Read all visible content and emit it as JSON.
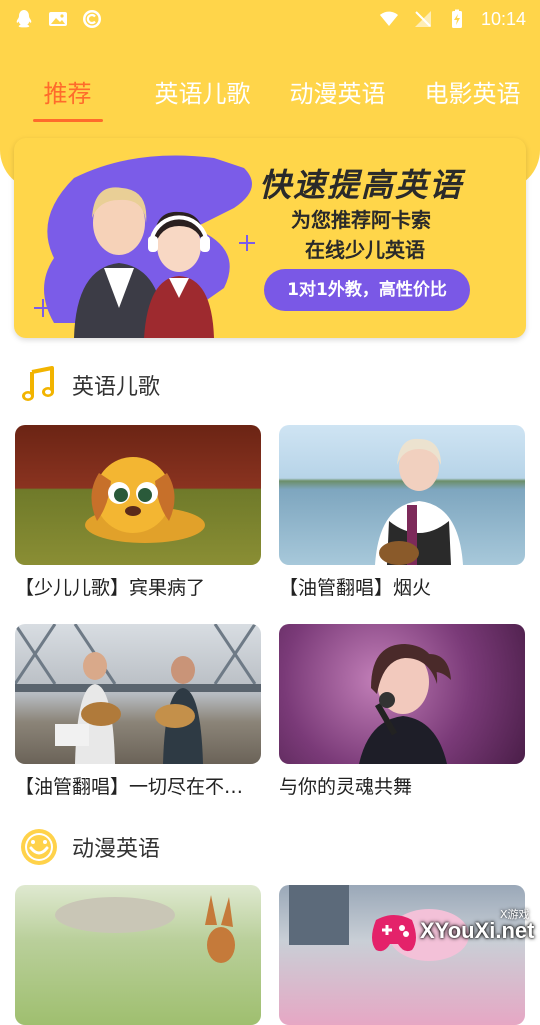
{
  "status_bar": {
    "time": "10:14"
  },
  "tabs": [
    {
      "label": "推荐",
      "active": true
    },
    {
      "label": "英语儿歌",
      "active": false
    },
    {
      "label": "动漫英语",
      "active": false
    },
    {
      "label": "电影英语",
      "active": false
    }
  ],
  "banner": {
    "title": "快速提高英语",
    "subtitle_line1": "为您推荐阿卡索",
    "subtitle_line2": "在线少儿英语",
    "pill": "1对1外教，高性价比"
  },
  "sections": [
    {
      "title": "英语儿歌",
      "icon": "music-note-icon",
      "cards": [
        {
          "caption": "【少儿儿歌】宾果病了"
        },
        {
          "caption": "【油管翻唱】烟火"
        },
        {
          "caption": "【油管翻唱】一切尽在不言中"
        },
        {
          "caption": "与你的灵魂共舞"
        }
      ]
    },
    {
      "title": "动漫英语",
      "icon": "smiley-icon",
      "cards": []
    }
  ],
  "watermark": {
    "text": "XYouXi.net",
    "small": "X游戏"
  },
  "colors": {
    "header": "#ffd54a",
    "accent": "#ff6b2b",
    "pill": "#7a58e6"
  }
}
